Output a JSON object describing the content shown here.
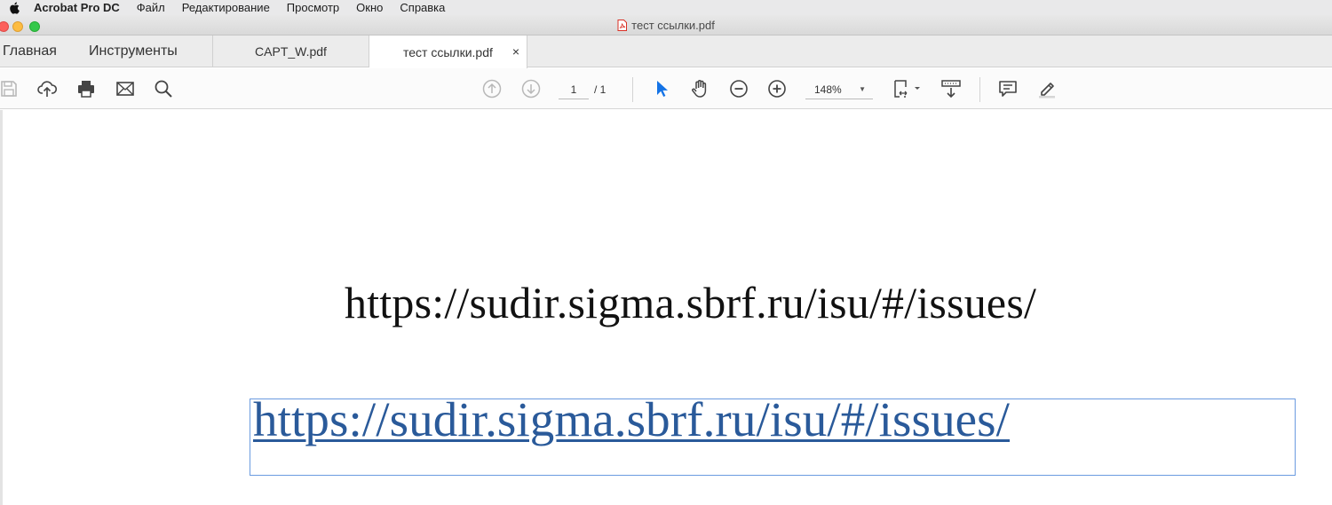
{
  "menubar": {
    "app_name": "Acrobat Pro DC",
    "items": [
      "Файл",
      "Редактирование",
      "Просмотр",
      "Окно",
      "Справка"
    ]
  },
  "window": {
    "title": "тест ссылки.pdf"
  },
  "tabs": {
    "home": "Главная",
    "tools": "Инструменты",
    "doc1": "CAPT_W.pdf",
    "doc2": "тест ссылки.pdf",
    "close": "×"
  },
  "toolbar": {
    "page_current": "1",
    "page_total": "/ 1",
    "zoom": "148%",
    "icons": [
      "save-icon",
      "upload-icon",
      "print-icon",
      "mail-icon",
      "search-icon",
      "prev-page-icon",
      "next-page-icon",
      "select-cursor-icon",
      "hand-icon",
      "zoom-out-icon",
      "zoom-in-icon",
      "page-fit-icon",
      "scroll-mode-icon",
      "comment-icon",
      "highlight-icon"
    ]
  },
  "document": {
    "plain_text": "https://sudir.sigma.sbrf.ru/isu/#/issues/",
    "link_text": "https://sudir.sigma.sbrf.ru/isu/#/issues/"
  },
  "colors": {
    "link": "#2a5a9a",
    "link_box": "#6b9be0",
    "select_tool": "#1473e6"
  }
}
